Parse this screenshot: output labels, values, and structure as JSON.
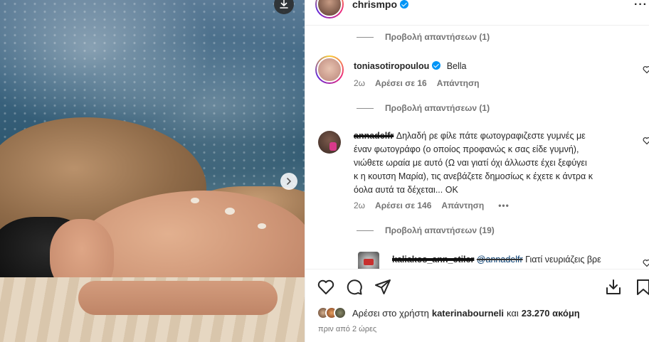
{
  "post": {
    "author": "chrismpo",
    "verified": true,
    "image_alt": "photo",
    "buttons": {
      "download": "download",
      "next": "next"
    }
  },
  "comments": [
    {
      "replies_toggle": "Προβολή απαντήσεων (1)"
    },
    {
      "username": "toniasotiropoulou",
      "verified": true,
      "text": "Bella",
      "age": "2ω",
      "likes": "Αρέσει σε 16",
      "reply": "Απάντηση",
      "replies_toggle": "Προβολή απαντήσεων (1)"
    },
    {
      "username": "annadelfr",
      "text_lines": [
        "Δηλαδή ρε φίλε πάτε φωτογραφιζεστε γυμνές με",
        "έναν φωτογράφο (ο οποίος προφανώς κ σας είδε γυμνή),",
        "νιώθετε ωραία με αυτό (Ω ναι γιατί όχι άλλωστε έχει ξεφύγει",
        "κ η κουτση Μαρία), τις ανεβάζετε δημοσίως κ έχετε κ άντρα κ",
        "όολα αυτά τα δέχεται... ΟΚ"
      ],
      "age": "2ω",
      "likes": "Αρέσει σε 146",
      "reply": "Απάντηση",
      "more": "•••",
      "replies_toggle": "Προβολή απαντήσεων (19)"
    },
    {
      "username": "kaliakos_ann_etiler",
      "mention": "@annadelfr",
      "text": "Γιατί νευριάζεις βρε"
    }
  ],
  "likes_summary": {
    "prefix": "Αρέσει στο χρήστη",
    "user": "katerinabourneli",
    "conj": "και",
    "others": "23.270 ακόμη",
    "time": "πριν από 2 ώρες"
  },
  "colors": {
    "verified": "#0095f6",
    "muted": "#737373",
    "text": "#262626"
  },
  "icons": [
    "download-icon",
    "chevron-right-icon",
    "more-icon",
    "heart-icon",
    "comment-icon",
    "share-icon",
    "save-icon",
    "verified-icon"
  ]
}
